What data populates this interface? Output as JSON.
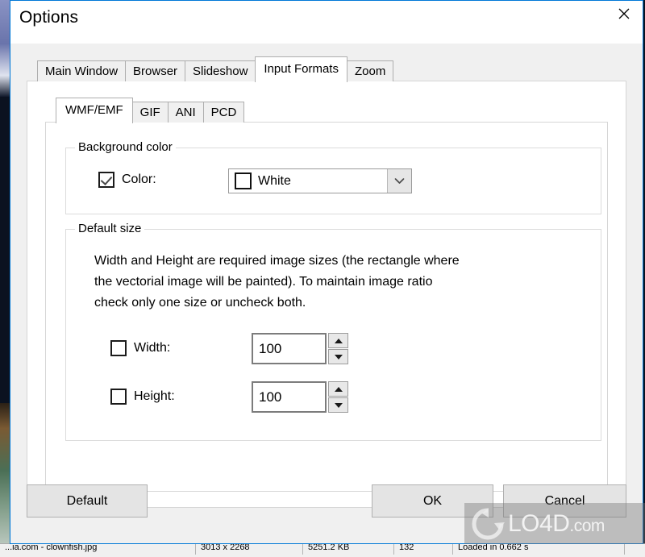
{
  "window": {
    "title": "Options",
    "close_icon": "close-x-icon"
  },
  "outer_tabs": {
    "items": [
      {
        "label": "Main Window",
        "active": false
      },
      {
        "label": "Browser",
        "active": false
      },
      {
        "label": "Slideshow",
        "active": false
      },
      {
        "label": "Input Formats",
        "active": true
      },
      {
        "label": "Zoom",
        "active": false
      }
    ]
  },
  "inner_tabs": {
    "items": [
      {
        "label": "WMF/EMF",
        "active": true
      },
      {
        "label": "GIF",
        "active": false
      },
      {
        "label": "ANI",
        "active": false
      },
      {
        "label": "PCD",
        "active": false
      }
    ]
  },
  "background_color_group": {
    "legend": "Background color",
    "color_checkbox": {
      "label": "Color:",
      "checked": true
    },
    "color_combo": {
      "value": "White",
      "swatch_hex": "#ffffff",
      "arrow_icon": "chevron-down-icon"
    }
  },
  "default_size_group": {
    "legend": "Default size",
    "description": "Width and Height are required image sizes (the rectangle where\nthe vectorial image will be painted). To maintain image ratio\ncheck only one size or uncheck both.",
    "width": {
      "label": "Width:",
      "checked": false,
      "value": "100",
      "spin_up_icon": "triangle-up-icon",
      "spin_down_icon": "triangle-down-icon"
    },
    "height": {
      "label": "Height:",
      "checked": false,
      "value": "100",
      "spin_up_icon": "triangle-up-icon",
      "spin_down_icon": "triangle-down-icon"
    }
  },
  "buttons": {
    "default": "Default",
    "ok": "OK",
    "cancel": "Cancel"
  },
  "status_bar": {
    "cells": [
      "...ia.com - clownfish.jpg",
      "3013 x 2268",
      "5251.2 KB",
      "132",
      "Loaded in 0.662 s"
    ]
  },
  "watermark": {
    "name": "LO4D",
    "domain": ".com",
    "logo_icon": "circular-arrow-icon"
  },
  "colors": {
    "dialog_border": "#0078d7",
    "dialog_face": "#f0f0f0",
    "panel": "#ffffff",
    "group_border": "#dcdcdc"
  }
}
